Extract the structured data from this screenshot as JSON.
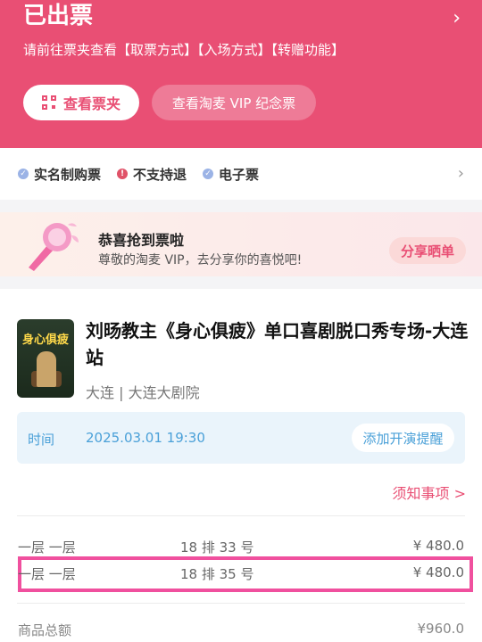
{
  "header": {
    "title": "已出票",
    "subtitle": "请前往票夹查看【取票方式】【入场方式】【转赠功能】",
    "wallet_button": "查看票夹",
    "vip_button": "查看淘麦 VIP 纪念票"
  },
  "tags": [
    {
      "label": "实名制购票",
      "icon": "check-icon",
      "color": "#9bb3e6"
    },
    {
      "label": "不支持退",
      "icon": "exclamation-icon",
      "color": "#e05268"
    },
    {
      "label": "电子票",
      "icon": "check-icon",
      "color": "#9bb3e6"
    }
  ],
  "banner": {
    "title": "恭喜抢到票啦",
    "subtitle": "尊敬的淘麦 VIP，去分享你的喜悦吧!",
    "share_button": "分享晒单"
  },
  "show": {
    "poster_title": "身心俱疲",
    "title": "刘旸教主《身心俱疲》单口喜剧脱口秀专场-大连站",
    "venue": "大连 | 大连大剧院",
    "time_label": "时间",
    "time_value": "2025.03.01 19:30",
    "remind_button": "添加开演提醒",
    "notice_link": "须知事项 >"
  },
  "tickets": [
    {
      "area": "一层 一层",
      "seat": "18 排 33 号",
      "price": "¥ 480.0"
    },
    {
      "area": "一层 一层",
      "seat": "18 排 35 号",
      "price": "¥ 480.0"
    }
  ],
  "total": {
    "label": "商品总额",
    "value": "¥960.0"
  },
  "colors": {
    "accent": "#e94f74",
    "blue": "#4aa0d8",
    "highlight": "#f0509e"
  }
}
